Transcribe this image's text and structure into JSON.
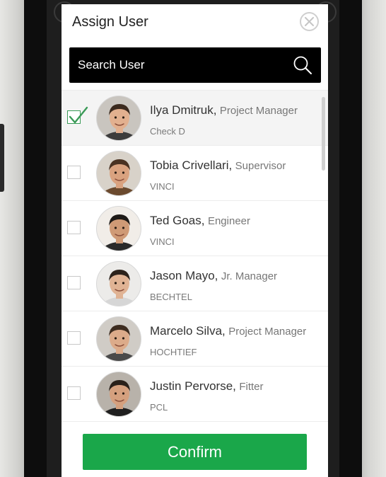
{
  "dialog": {
    "title": "Assign User",
    "close_icon": "close-circle-icon"
  },
  "search": {
    "placeholder": "Search User",
    "icon": "search-icon"
  },
  "users": [
    {
      "name": "Ilya Dmitruk,",
      "role": "Project Manager",
      "company": "Check D",
      "selected": true
    },
    {
      "name": "Tobia Crivellari,",
      "role": "Supervisor",
      "company": "VINCI",
      "selected": false
    },
    {
      "name": "Ted Goas,",
      "role": "Engineer",
      "company": "VINCI",
      "selected": false
    },
    {
      "name": "Jason Mayo,",
      "role": "Jr. Manager",
      "company": "BECHTEL",
      "selected": false
    },
    {
      "name": "Marcelo Silva,",
      "role": "Project Manager",
      "company": "HOCHTIEF",
      "selected": false
    },
    {
      "name": "Justin Pervorse,",
      "role": "Fitter",
      "company": "PCL",
      "selected": false
    }
  ],
  "confirm_label": "Confirm",
  "colors": {
    "accent": "#1aa74a",
    "check": "#3a9a57",
    "search_bg": "#000000"
  }
}
